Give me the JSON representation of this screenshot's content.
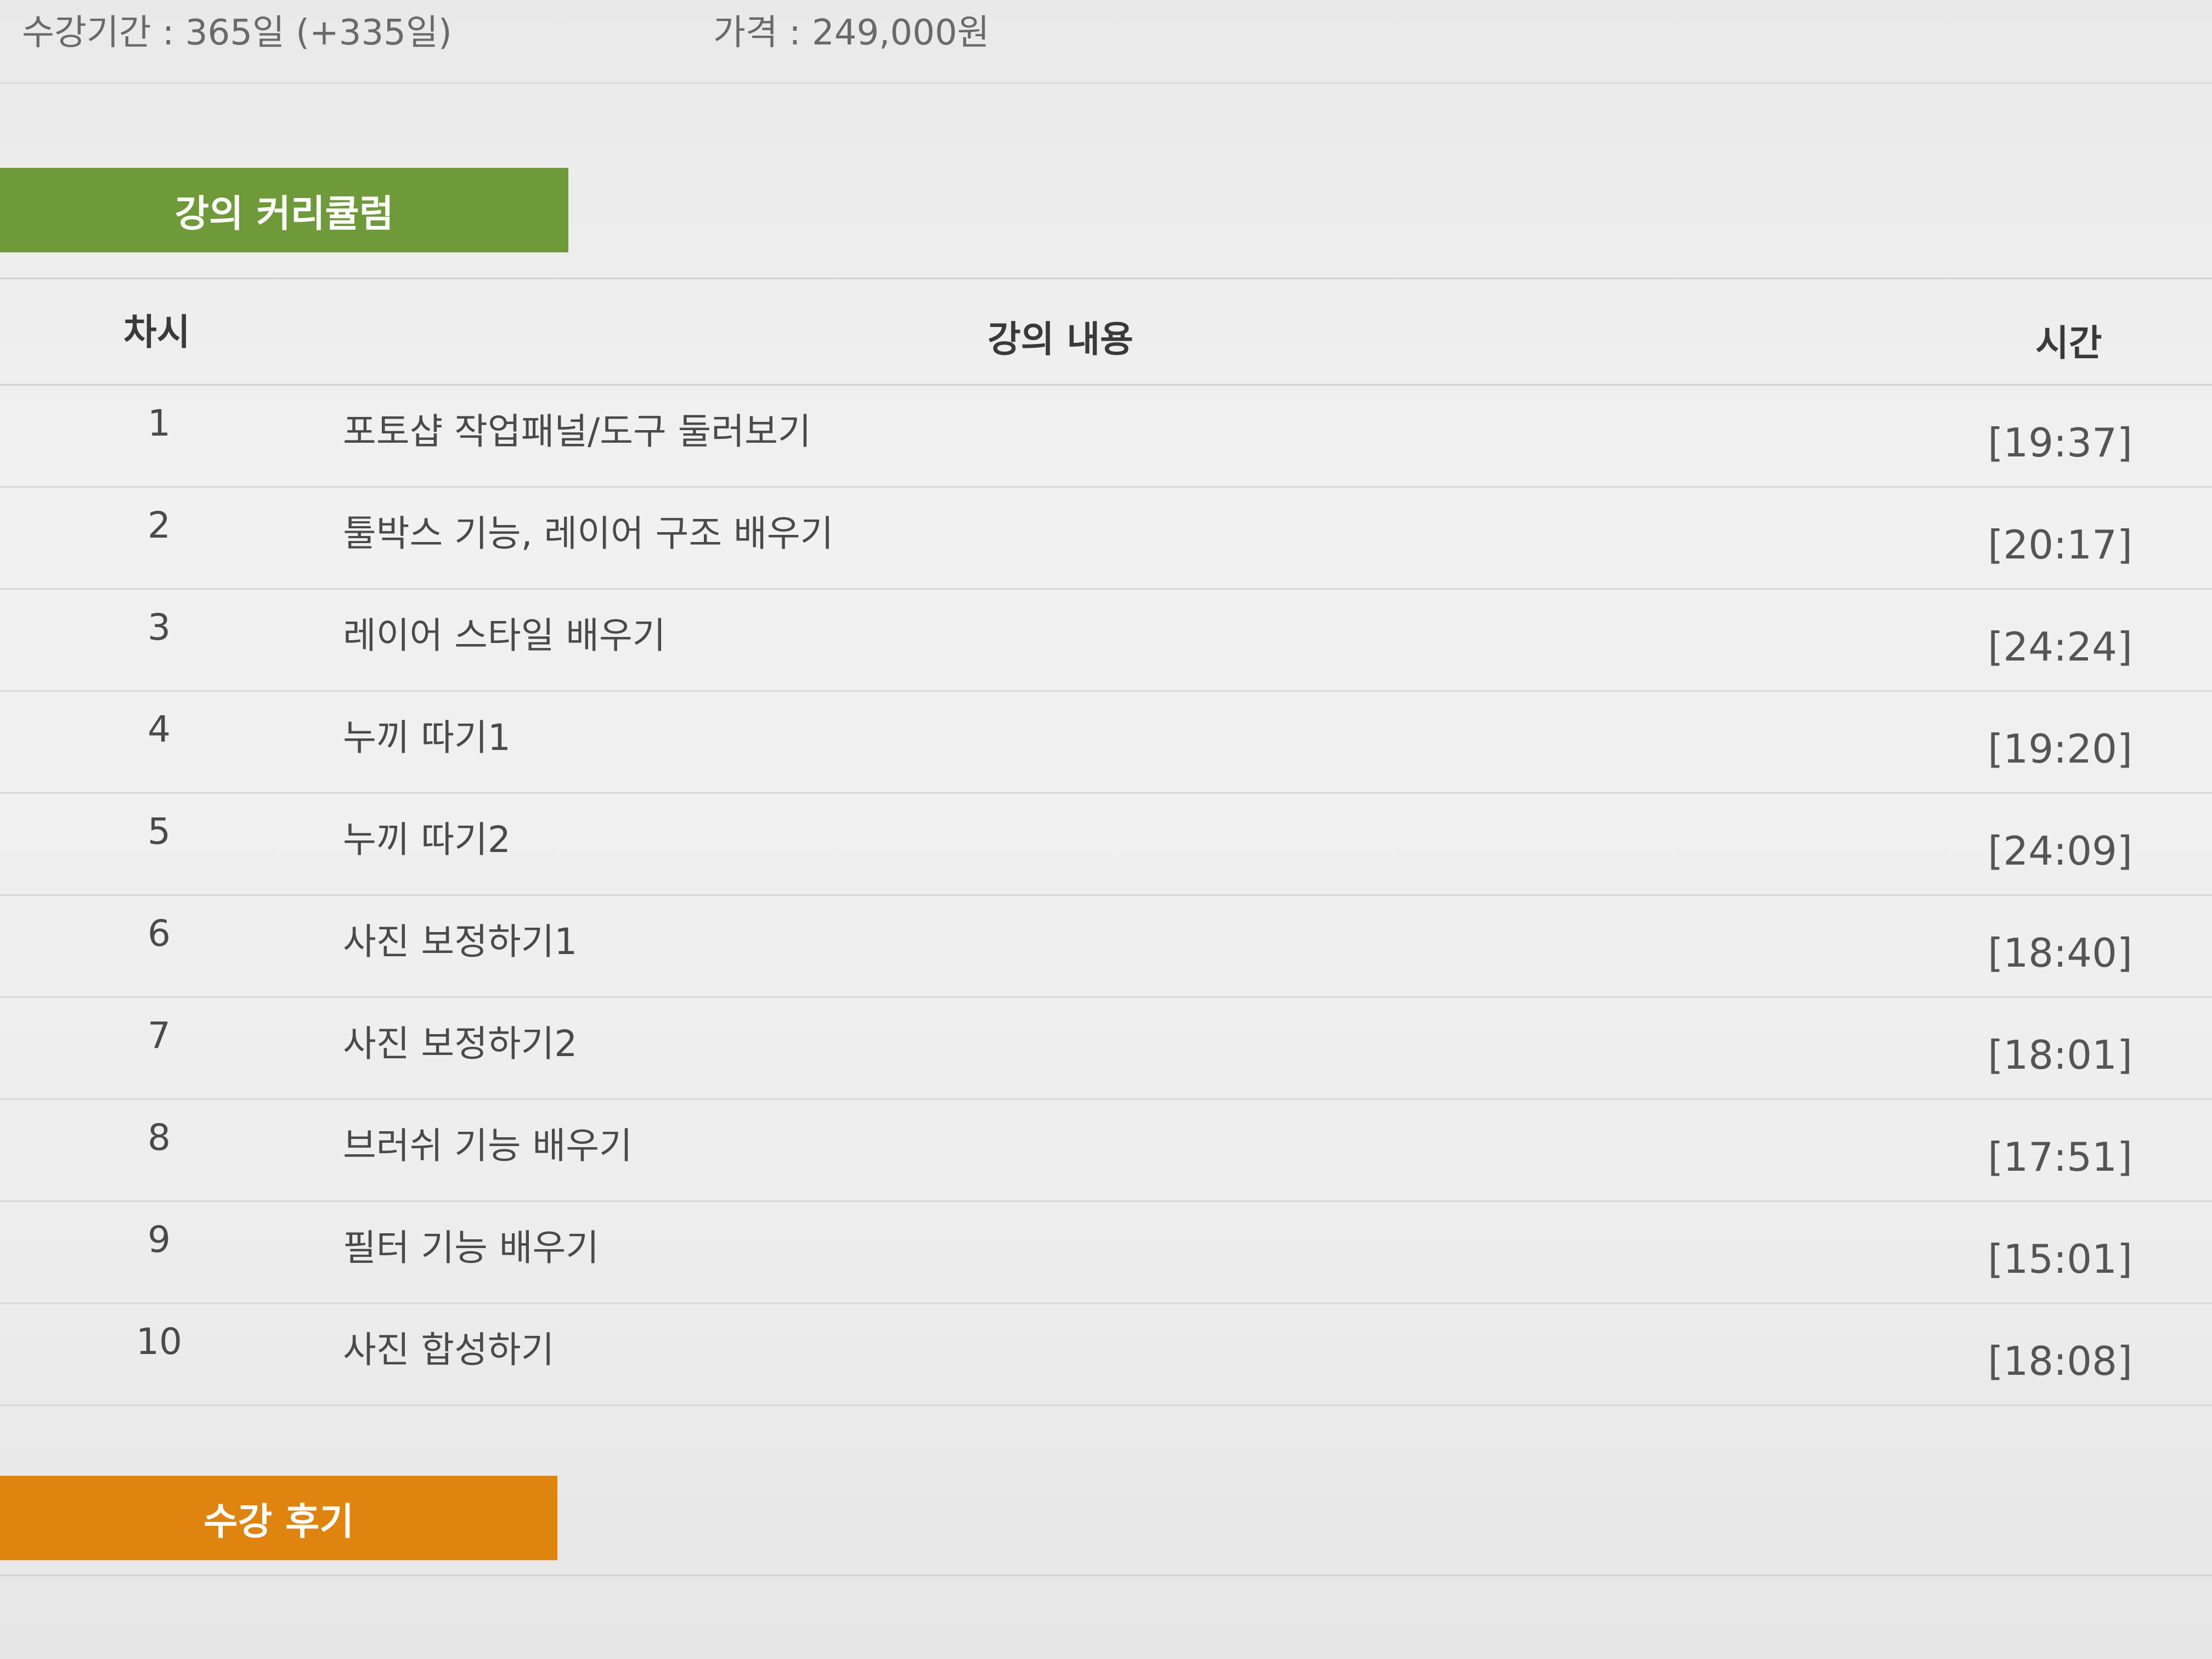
{
  "info": {
    "period": "수강기간 : 365일 (+335일)",
    "price": "가격 : 249,000원"
  },
  "colors": {
    "curriculum_tab": "#6e9a3a",
    "reviews_tab": "#e08410"
  },
  "curriculum_tab": {
    "label": "강의 커리큘럼"
  },
  "table": {
    "headers": {
      "no": "차시",
      "title": "강의 내용",
      "time": "시간"
    },
    "rows": [
      {
        "no": "1",
        "title": "포토샵 작업패널/도구 둘러보기",
        "time": "[19:37]"
      },
      {
        "no": "2",
        "title": "툴박스 기능, 레이어 구조 배우기",
        "time": "[20:17]"
      },
      {
        "no": "3",
        "title": "레이어 스타일 배우기",
        "time": "[24:24]"
      },
      {
        "no": "4",
        "title": "누끼 따기1",
        "time": "[19:20]"
      },
      {
        "no": "5",
        "title": "누끼 따기2",
        "time": "[24:09]"
      },
      {
        "no": "6",
        "title": "사진 보정하기1",
        "time": "[18:40]"
      },
      {
        "no": "7",
        "title": "사진 보정하기2",
        "time": "[18:01]"
      },
      {
        "no": "8",
        "title": "브러쉬 기능 배우기",
        "time": "[17:51]"
      },
      {
        "no": "9",
        "title": "필터 기능 배우기",
        "time": "[15:01]"
      },
      {
        "no": "10",
        "title": "사진 합성하기",
        "time": "[18:08]"
      }
    ]
  },
  "reviews_tab": {
    "label": "수강 후기"
  }
}
